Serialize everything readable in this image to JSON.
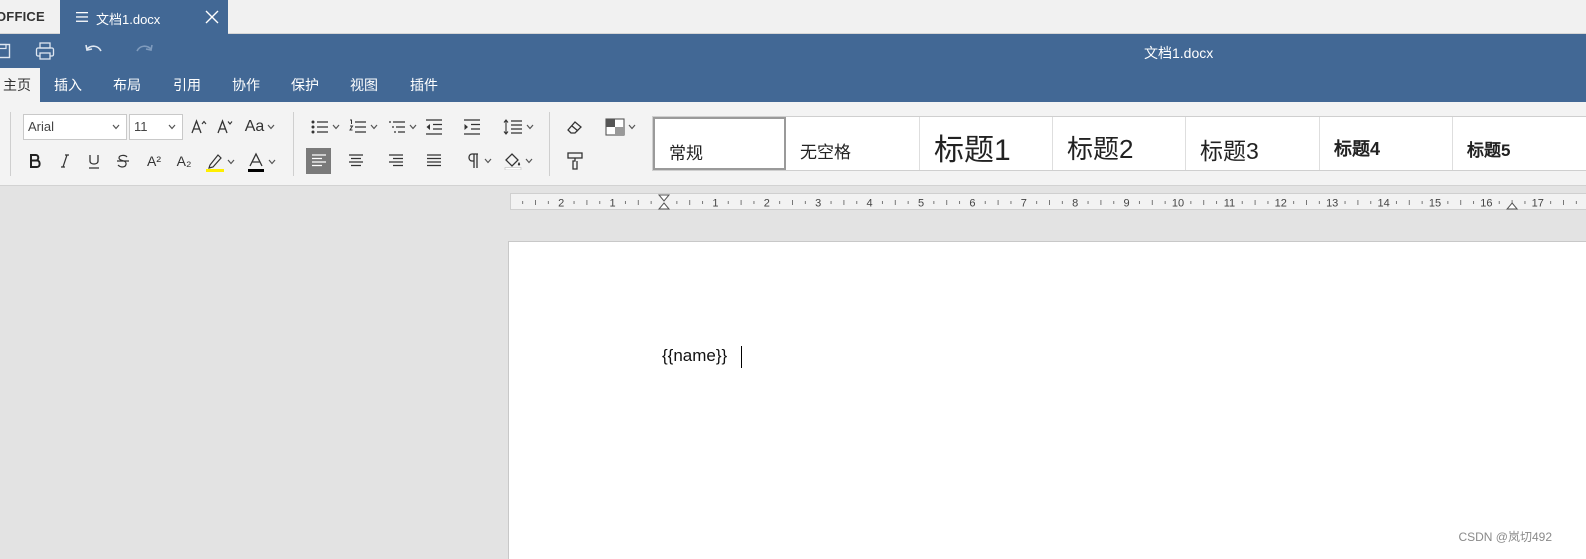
{
  "app": {
    "brand": "OFFICE",
    "tab": {
      "label": "文档1.docx"
    },
    "title": "文档1.docx"
  },
  "menu": {
    "items": [
      {
        "label": "主页",
        "active": true
      },
      {
        "label": "插入"
      },
      {
        "label": "布局"
      },
      {
        "label": "引用"
      },
      {
        "label": "协作"
      },
      {
        "label": "保护"
      },
      {
        "label": "视图"
      },
      {
        "label": "插件"
      }
    ]
  },
  "toolbar": {
    "font_family": "Arial",
    "font_size": "11",
    "change_case_label": "Aa",
    "superscript_label": "A²",
    "subscript_label": "A₂",
    "highlight_color": "#ffef00",
    "font_color": "#000000"
  },
  "styles": [
    {
      "label": "常规",
      "selected": true
    },
    {
      "label": "无空格"
    },
    {
      "label": "标题1"
    },
    {
      "label": "标题2"
    },
    {
      "label": "标题3"
    },
    {
      "label": "标题4"
    },
    {
      "label": "标题5"
    }
  ],
  "ruler": {
    "left_numbers": [
      "2",
      "1"
    ],
    "right_numbers": [
      "1",
      "2",
      "3",
      "4",
      "5",
      "6",
      "7",
      "8",
      "9",
      "10",
      "11",
      "12",
      "13",
      "14",
      "15",
      "16",
      "17"
    ]
  },
  "document": {
    "text": "{{name}}"
  },
  "watermark": "CSDN @岚切492",
  "colors": {
    "header": "#426895",
    "toolbar": "#f3f3f3",
    "workspace": "#e3e3e3"
  }
}
